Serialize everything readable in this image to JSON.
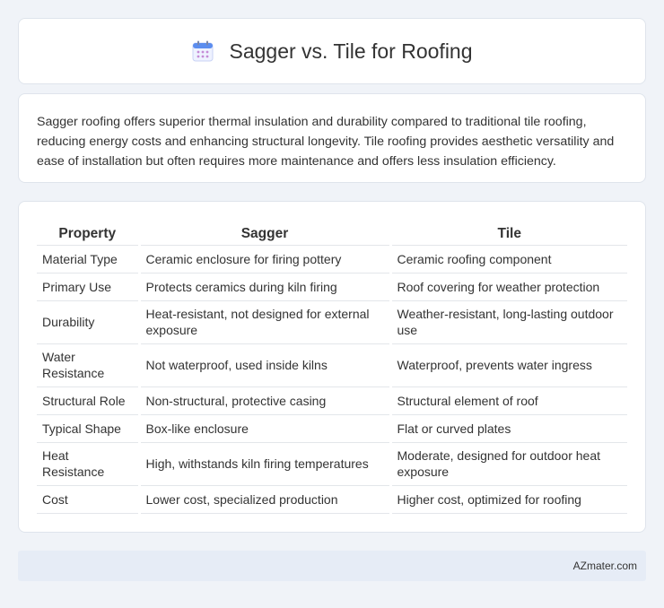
{
  "header": {
    "title": "Sagger vs. Tile for Roofing",
    "icon": "calendar-icon",
    "accent": "#5b8def"
  },
  "summary": {
    "text": "Sagger roofing offers superior thermal insulation and durability compared to traditional tile roofing, reducing energy costs and enhancing structural longevity. Tile roofing provides aesthetic versatility and ease of installation but often requires more maintenance and offers less insulation efficiency."
  },
  "table": {
    "headers": [
      "Property",
      "Sagger",
      "Tile"
    ],
    "rows": [
      {
        "property": "Material Type",
        "sagger": "Ceramic enclosure for firing pottery",
        "tile": "Ceramic roofing component"
      },
      {
        "property": "Primary Use",
        "sagger": "Protects ceramics during kiln firing",
        "tile": "Roof covering for weather protection"
      },
      {
        "property": "Durability",
        "sagger": "Heat-resistant, not designed for external exposure",
        "tile": "Weather-resistant, long-lasting outdoor use"
      },
      {
        "property": "Water Resistance",
        "sagger": "Not waterproof, used inside kilns",
        "tile": "Waterproof, prevents water ingress"
      },
      {
        "property": "Structural Role",
        "sagger": "Non-structural, protective casing",
        "tile": "Structural element of roof"
      },
      {
        "property": "Typical Shape",
        "sagger": "Box-like enclosure",
        "tile": "Flat or curved plates"
      },
      {
        "property": "Heat Resistance",
        "sagger": "High, withstands kiln firing temperatures",
        "tile": "Moderate, designed for outdoor heat exposure"
      },
      {
        "property": "Cost",
        "sagger": "Lower cost, specialized production",
        "tile": "Higher cost, optimized for roofing"
      }
    ]
  },
  "footer": {
    "brand": "AZmater.com"
  }
}
